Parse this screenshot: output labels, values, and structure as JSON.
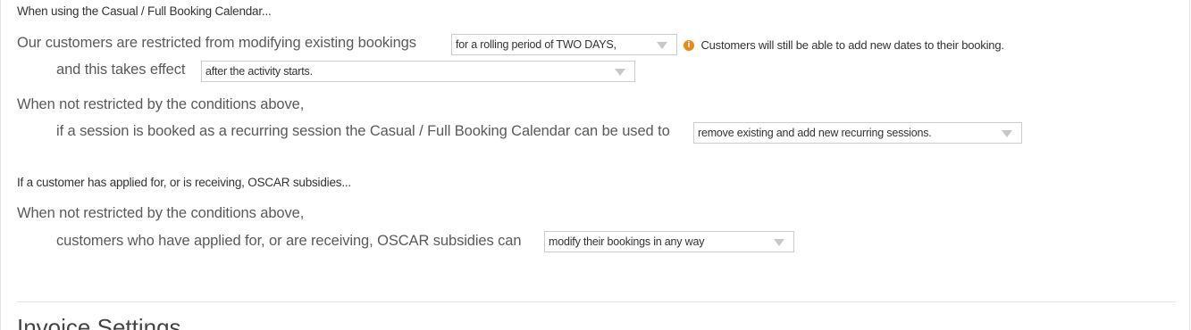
{
  "calendar_section": {
    "heading": "When using the Casual / Full Booking Calendar...",
    "restriction_label": "Our customers are restricted from modifying existing bookings",
    "restriction_select": "for a rolling period of TWO DAYS,",
    "restriction_note": "Customers will still be able to add new dates to their booking.",
    "effect_label": "and this takes effect",
    "effect_select": "after the activity starts.",
    "unrestricted_label": "When not restricted by the conditions above,",
    "recurring_label": "if a session is booked as a recurring session the Casual / Full Booking Calendar can be used to",
    "recurring_select": "remove existing and add new recurring sessions."
  },
  "oscar_section": {
    "heading": "If a customer has applied for, or is receiving, OSCAR subsidies...",
    "unrestricted_label": "When not restricted by the conditions above,",
    "subsidy_label": "customers who have applied for, or are receiving, OSCAR subsidies can",
    "subsidy_select": "modify their bookings in any way"
  },
  "invoice_section": {
    "title": "Invoice Settings"
  },
  "icons": {
    "info": "info-icon",
    "dropdown": "chevron-down-icon"
  },
  "colors": {
    "info_icon": "#e88a1a",
    "border": "#cccccc",
    "divider": "#e5e5e5"
  }
}
